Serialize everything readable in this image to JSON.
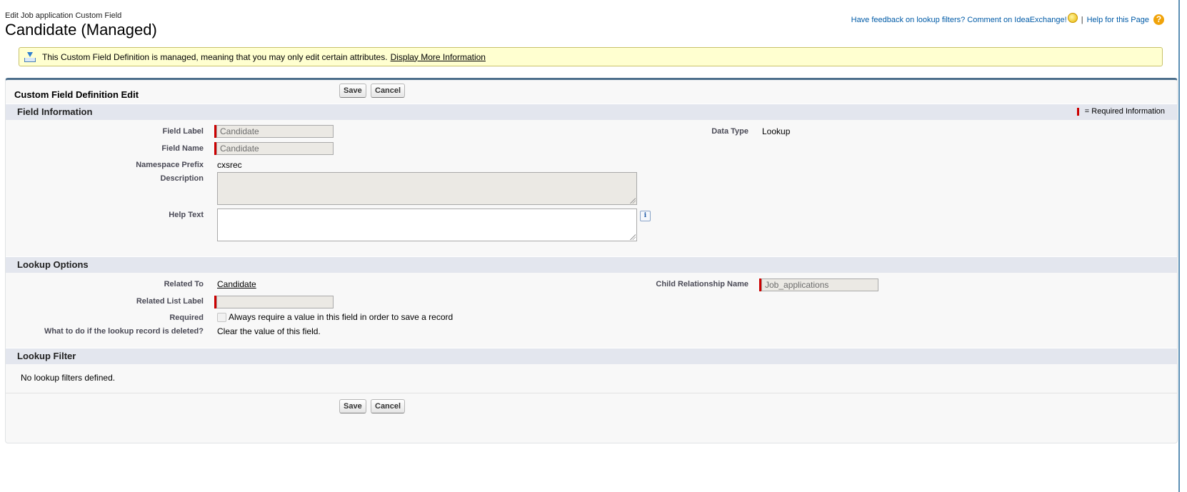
{
  "header": {
    "subtitle": "Edit Job application Custom Field",
    "title": "Candidate (Managed)"
  },
  "help_links": {
    "feedback_text": "Have feedback on lookup filters? Comment on IdeaExchange!",
    "separator": "|",
    "help_page": "Help for this Page",
    "help_icon_glyph": "?"
  },
  "banner": {
    "icon": "download-icon",
    "text": "This Custom Field Definition is managed, meaning that you may only edit certain attributes.",
    "link": "Display More Information"
  },
  "page_block": {
    "title": "Custom Field Definition Edit",
    "save_label": "Save",
    "cancel_label": "Cancel"
  },
  "field_information": {
    "heading": "Field Information",
    "required_legend": "= Required Information",
    "field_label_label": "Field Label",
    "field_label_value": "Candidate",
    "field_name_label": "Field Name",
    "field_name_value": "Candidate",
    "namespace_label": "Namespace Prefix",
    "namespace_value": "cxsrec",
    "description_label": "Description",
    "description_value": "",
    "help_text_label": "Help Text",
    "help_text_value": "",
    "help_info_glyph": "i",
    "data_type_label": "Data Type",
    "data_type_value": "Lookup"
  },
  "lookup_options": {
    "heading": "Lookup Options",
    "related_to_label": "Related To",
    "related_to_value": "Candidate",
    "related_list_label_label": "Related List Label",
    "related_list_label_value": "",
    "required_label": "Required",
    "required_checkbox_text": "Always require a value in this field in order to save a record",
    "required_checked": false,
    "deleted_label": "What to do if the lookup record is deleted?",
    "deleted_value": "Clear the value of this field.",
    "child_rel_label": "Child Relationship Name",
    "child_rel_value": "Job_applications"
  },
  "lookup_filter": {
    "heading": "Lookup Filter",
    "empty_text": "No lookup filters defined."
  },
  "colors": {
    "required_red": "#cc0000",
    "section_bg": "#e3e6ee",
    "banner_bg": "#ffffd0",
    "link_blue": "#015ba7",
    "block_border": "#4d6f8c"
  }
}
